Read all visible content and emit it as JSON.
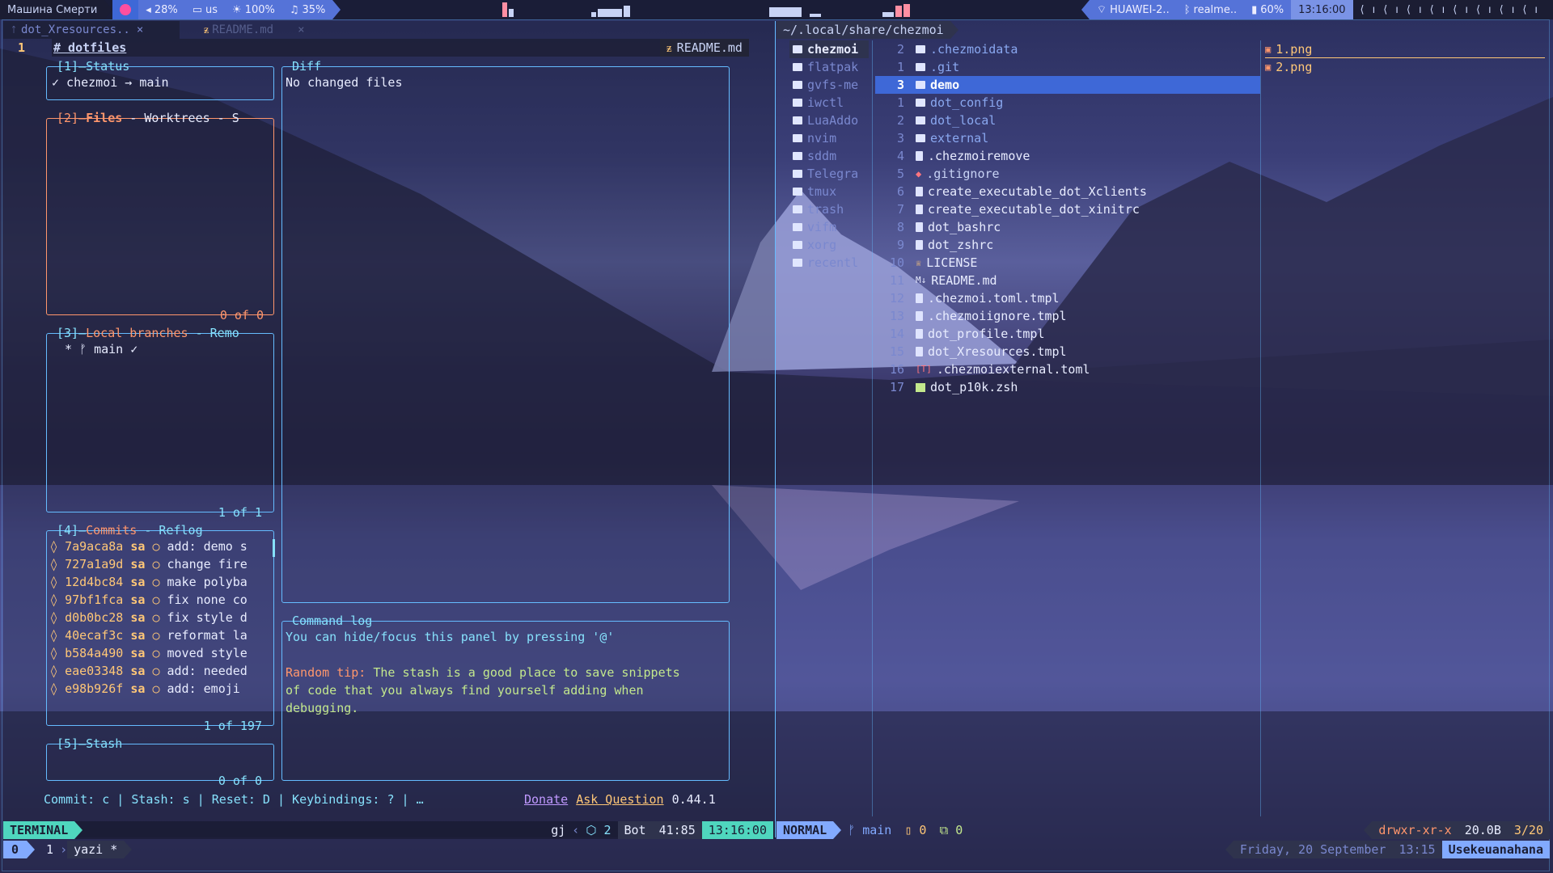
{
  "topbar": {
    "workspace": "Машина Смерти",
    "volume": "28%",
    "layout": "us",
    "brightness": "100%",
    "music": "35%",
    "wifi": "HUAWEI-2..",
    "bluetooth": "realme..",
    "battery": "60%",
    "clock": "13:16:00"
  },
  "tabs": {
    "tab1": "dot_Xresources..",
    "tab1_close": "×",
    "tab2": "README.md",
    "tab2_close": "×"
  },
  "editor": {
    "line_number": "1",
    "heading": "# dotfiles",
    "file_badge": "README.md"
  },
  "lazygit": {
    "status": {
      "title": "[1]–Status",
      "branch_line": "✓ chezmoi → main"
    },
    "files": {
      "title_num": "[2]–",
      "title_a": "Files",
      "title_b": " - Worktrees - S",
      "footer": "0 of 0"
    },
    "branches": {
      "title_num": "[3]–",
      "title_a": "Local branches",
      "title_b": " - Remo",
      "item": "* ᚠ main ✓",
      "footer": "1 of 1"
    },
    "commits": {
      "title_num": "[4]–",
      "title_a": "Commits",
      "title_b": " - Reflog",
      "footer": "1 of 197",
      "rows": [
        {
          "hash": "7a9aca8a",
          "author": "sa",
          "msg": "add: demo s"
        },
        {
          "hash": "727a1a9d",
          "author": "sa",
          "msg": "change fire"
        },
        {
          "hash": "12d4bc84",
          "author": "sa",
          "msg": "make polyba"
        },
        {
          "hash": "97bf1fca",
          "author": "sa",
          "msg": "fix none co"
        },
        {
          "hash": "d0b0bc28",
          "author": "sa",
          "msg": "fix style d"
        },
        {
          "hash": "40ecaf3c",
          "author": "sa",
          "msg": "reformat la"
        },
        {
          "hash": "b584a490",
          "author": "sa",
          "msg": "moved style"
        },
        {
          "hash": "eae03348",
          "author": "sa",
          "msg": "add: needed"
        },
        {
          "hash": "e98b926f",
          "author": "sa",
          "msg": "add: emoji "
        }
      ]
    },
    "stash": {
      "title": "[5]–Stash",
      "footer": "0 of 0"
    },
    "diff": {
      "title": "Diff",
      "text": "No changed files"
    },
    "cmdlog": {
      "title": "Command log",
      "line1": "You can hide/focus this panel by pressing '@'",
      "tip_label": "Random tip:",
      "tip1": " The stash is a good place to save snippets",
      "tip2": "of code that you always find yourself adding when",
      "tip3": "debugging."
    },
    "helpbar": {
      "keys": "Commit: c | Stash: s | Reset: D | Keybindings: ? | …",
      "donate": "Donate",
      "ask": "Ask Question",
      "version": "0.44.1"
    }
  },
  "yazi": {
    "path": "~/.local/share/chezmoi",
    "parent": [
      "chezmoi",
      "flatpak",
      "gvfs-me",
      "iwctl",
      "LuaAddo",
      "nvim",
      "sddm",
      "Telegra",
      "tmux",
      "trash",
      "vifm",
      "xorg",
      "recentl"
    ],
    "files": [
      {
        "n": "2",
        "name": ".chezmoidata",
        "t": "dir"
      },
      {
        "n": "1",
        "name": ".git",
        "t": "dir"
      },
      {
        "n": "3",
        "name": "demo",
        "t": "dir",
        "sel": true
      },
      {
        "n": "1",
        "name": "dot_config",
        "t": "dir"
      },
      {
        "n": "2",
        "name": "dot_local",
        "t": "dir"
      },
      {
        "n": "3",
        "name": "external",
        "t": "dir"
      },
      {
        "n": "4",
        "name": ".chezmoiremove",
        "t": "file"
      },
      {
        "n": "5",
        "name": ".gitignore",
        "t": "git"
      },
      {
        "n": "6",
        "name": "create_executable_dot_Xclients",
        "t": "file"
      },
      {
        "n": "7",
        "name": "create_executable_dot_xinitrc",
        "t": "file"
      },
      {
        "n": "8",
        "name": "dot_bashrc",
        "t": "file"
      },
      {
        "n": "9",
        "name": "dot_zshrc",
        "t": "file"
      },
      {
        "n": "10",
        "name": "LICENSE",
        "t": "lic"
      },
      {
        "n": "11",
        "name": "README.md",
        "t": "md"
      },
      {
        "n": "12",
        "name": ".chezmoi.toml.tmpl",
        "t": "file"
      },
      {
        "n": "13",
        "name": ".chezmoiignore.tmpl",
        "t": "file"
      },
      {
        "n": "14",
        "name": "dot_profile.tmpl",
        "t": "file"
      },
      {
        "n": "15",
        "name": "dot_Xresources.tmpl",
        "t": "file"
      },
      {
        "n": "16",
        "name": ".chezmoiexternal.toml",
        "t": "toml"
      },
      {
        "n": "17",
        "name": "dot_p10k.zsh",
        "t": "zsh"
      }
    ],
    "preview": [
      "1.png",
      "2.png"
    ]
  },
  "statusline_left": {
    "mode": "TERMINAL",
    "keys": "gj",
    "count": "2",
    "pos": "Bot",
    "cursor": "41:85",
    "time": "13:16:00"
  },
  "statusline_right": {
    "mode": "NORMAL",
    "branch": "main",
    "added": "0",
    "changed": "0",
    "perms": "drwxr-xr-x",
    "size": "20.0B",
    "count": "3/20"
  },
  "tmux": {
    "session": "0",
    "window": "1",
    "name": "yazi *",
    "date": "Friday, 20 September",
    "time": "13:15",
    "user": "Usekeuanahana"
  },
  "colors": {
    "accent": "#86e1fc",
    "border": "#65bcff",
    "orange": "#ff966c",
    "green": "#c3e88d",
    "selection": "#3e68d7"
  }
}
